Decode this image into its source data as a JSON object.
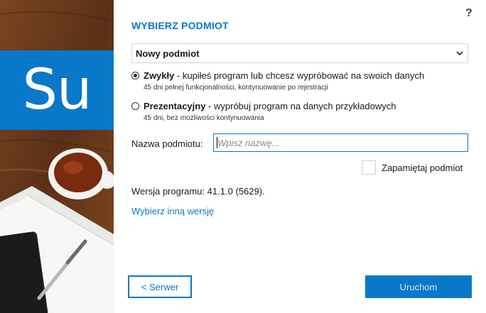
{
  "brand": {
    "logo_text": "Su"
  },
  "header": {
    "title": "WYBIERZ PODMIOT",
    "help_symbol": "?"
  },
  "subject_select": {
    "selected": "Nowy podmiot"
  },
  "options": [
    {
      "name": "Zwykły",
      "description": " - kupiłeś program lub chcesz wypróbować na swoich danych",
      "details": "45 dni pełnej funkcjonalności, kontynuowanie po rejestracji",
      "checked": true
    },
    {
      "name": "Prezentacyjny",
      "description": " - wypróbuj program na danych przykładowych",
      "details": "45 dni, bez możliwości kontynuowania",
      "checked": false
    }
  ],
  "name_field": {
    "label": "Nazwa podmiotu:",
    "value": "",
    "placeholder": "Wpisz nazwę..."
  },
  "remember": {
    "label": "Zapamiętaj podmiot",
    "checked": false
  },
  "version": {
    "text": "Wersja programu: 41.1.0 (5629)."
  },
  "other_version_link": "Wybierz inną wersję",
  "buttons": {
    "server": "< Serwer",
    "run": "Uruchom"
  },
  "colors": {
    "accent": "#0a78c8",
    "run_button_text": "#cfe4f6"
  }
}
